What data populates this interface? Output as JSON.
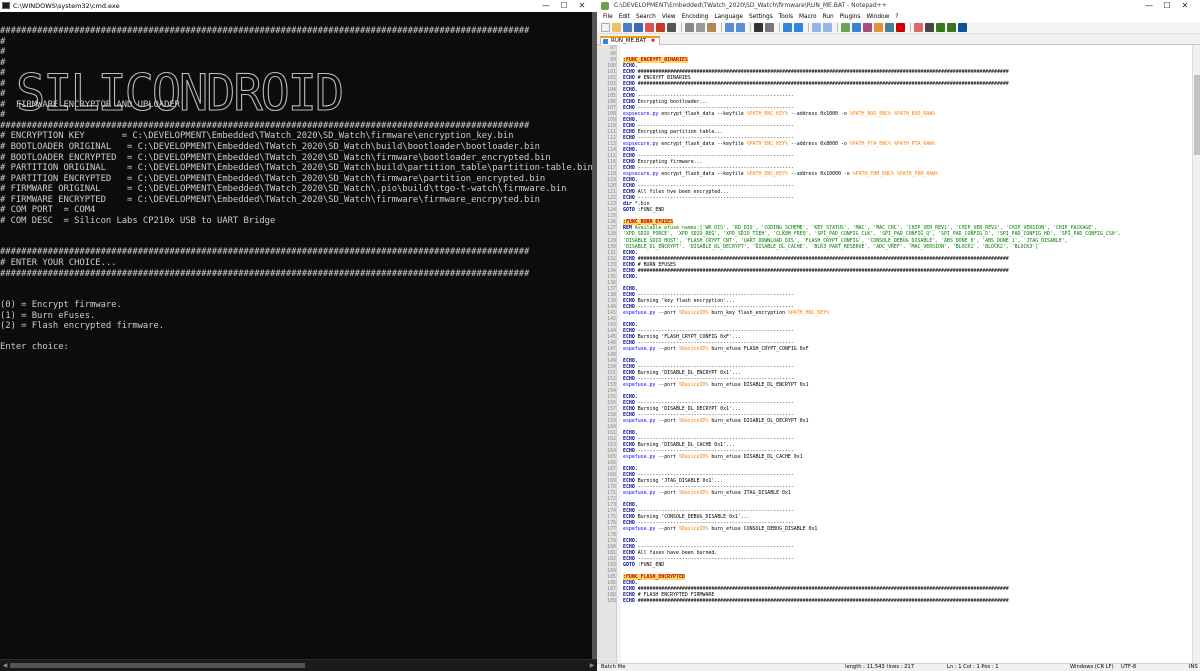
{
  "cmd": {
    "title": "C:\\WINDOWS\\system32\\cmd.exe",
    "lines": [
      "####################################################################################################",
      "#",
      "#",
      "#",
      "#",
      "#",
      "#",
      "#  FIRMWARE ENCRYPTOR AND UPLOADER",
      "#",
      "####################################################################################################",
      "# ENCRYPTION KEY       = C:\\DEVELOPMENT\\Embedded\\TWatch_2020\\SD_Watch\\firmware\\encryption_key.bin",
      "# BOOTLOADER ORIGINAL   = C:\\DEVELOPMENT\\Embedded\\TWatch_2020\\SD_Watch\\build\\bootloader\\bootloader.bin",
      "# BOOTLOADER ENCRYPTED  = C:\\DEVELOPMENT\\Embedded\\TWatch_2020\\SD_Watch\\firmware\\bootloader_encrypted.bin",
      "# PARTITION ORIGINAL    = C:\\DEVELOPMENT\\Embedded\\TWatch_2020\\SD_Watch\\build\\partition_table\\partition-table.bin",
      "# PARTITION ENCRYPTED   = C:\\DEVELOPMENT\\Embedded\\TWatch_2020\\SD_Watch\\firmware\\partition_encrypted.bin",
      "# FIRMWARE ORIGINAL     = C:\\DEVELOPMENT\\Embedded\\TWatch_2020\\SD_Watch\\.pio\\build\\ttgo-t-watch\\firmware.bin",
      "# FIRMWARE ENCRYPTED    = C:\\DEVELOPMENT\\Embedded\\TWatch_2020\\SD_Watch\\firmware\\firmware_encrpyted.bin",
      "# COM PORT  = COM4",
      "# COM DESC  = Silicon Labs CP210x USB to UART Bridge",
      "",
      "",
      "####################################################################################################",
      "# ENTER YOUR CHOICE...",
      "####################################################################################################",
      "",
      "",
      "(0) = Encrypt firmware.",
      "(1) = Burn eFuses.",
      "(2) = Flash encrypted firmware.",
      "",
      "Enter choice:"
    ],
    "ascii_art_text": "SILICONDROID"
  },
  "npp": {
    "title": "C:\\DEVELOPMENT\\Embedded\\TWatch_2020\\SD_Watch\\firmware\\RUN_ME.BAT - Notepad++",
    "menu": [
      "File",
      "Edit",
      "Search",
      "View",
      "Encoding",
      "Language",
      "Settings",
      "Tools",
      "Macro",
      "Run",
      "Plugins",
      "Window",
      "?"
    ],
    "tab_label": "RUN_ME.BAT",
    "first_line_number": 97,
    "code": [
      "",
      "",
      ":FUNC_ENCRYPT_BINARIES",
      "ECHO.",
      "ECHO ##############################################################################################################################",
      "ECHO # ENCRYPT BINARIES",
      "ECHO ##############################################################################################################################",
      "ECHO.",
      "ECHO -----------------------------------------------------",
      "ECHO Encrypting bootloader...",
      "ECHO -----------------------------------------------------",
      "espsecure.py encrypt_flash_data --keyfile %PATH_ENC_KEY% --address 0x1000 -o %PATH_BOO_ENC% %PATH_BOO_RAW%",
      "ECHO.",
      "ECHO -----------------------------------------------------",
      "ECHO Encrypting partition table...",
      "ECHO -----------------------------------------------------",
      "espsecure.py encrypt_flash_data --keyfile %PATH_ENC_KEY% --address 0x8000 -o %PATH_PTA_ENC% %PATH_PTA_RAW%",
      "ECHO.",
      "ECHO -----------------------------------------------------",
      "ECHO Encrypting firmware...",
      "ECHO -----------------------------------------------------",
      "espsecure.py encrypt_flash_data --keyfile %PATH_ENC_KEY% --address 0x10000 -o %PATH_FRM_ENC% %PATH_FRM_RAW%",
      "ECHO.",
      "ECHO -----------------------------------------------------",
      "ECHO All files hve been encrypted...",
      "ECHO -----------------------------------------------------",
      "dir *.bin",
      "GOTO :FUNC_END",
      "",
      ":FUNC_BURN_EFUSES",
      "REM Available efuse names:['WR_DIS', 'RD_DIS', 'CODING_SCHEME', 'KEY_STATUS', 'MAC', 'MAC_CRC', 'CHIP_VER_REV1', 'CHIP_VER_REV2', 'CHIP_VERSION', 'CHIP_PACKAGE',",
      "'XPD_SDIO_FORCE', 'XPD_SDIO_REG', 'XPD_SDIO_TIEH', 'CLK8M_FREQ', 'SPI_PAD_CONFIG_CLK', 'SPI_PAD_CONFIG_Q', 'SPI_PAD_CONFIG_D', 'SPI_PAD_CONFIG_HD', 'SPI_PAD_CONFIG_CS0',",
      "'DISABLE_SDIO_HOST', 'FLASH_CRYPT_CNT', 'UART_DOWNLOAD_DIS', 'FLASH_CRYPT_CONFIG', 'CONSOLE_DEBUG_DISABLE', 'ABS_DONE_0', 'ABS_DONE_1', 'JTAG_DISABLE',",
      "'DISABLE_DL_ENCRYPT', 'DISABLE_DL_DECRYPT', 'DISABLE_DL_CACHE', 'BLK3_PART_RESERVE', 'ADC_VREF', 'MAC_VERSION', 'BLOCK1', 'BLOCK2', 'BLOCK3']",
      "ECHO.",
      "ECHO ##############################################################################################################################",
      "ECHO # BURN EFUSES",
      "ECHO ##############################################################################################################################",
      "ECHO.",
      "",
      "ECHO.",
      "ECHO -----------------------------------------------------",
      "ECHO Burning 'key flash encryption'...",
      "ECHO -----------------------------------------------------",
      "espefuse.py --port %DeviceID% burn_key flash_encryption %PATH_ENC_KEY%",
      "",
      "ECHO.",
      "ECHO -----------------------------------------------------",
      "ECHO Burning 'FLASH_CRYPT_CONFIG 0xF'...",
      "ECHO -----------------------------------------------------",
      "espefuse.py --port %DeviceID% burn_efuse FLASH_CRYPT_CONFIG 0xF",
      "",
      "ECHO.",
      "ECHO -----------------------------------------------------",
      "ECHO Burning 'DISABLE_DL_ENCRYPT 0x1'...",
      "ECHO -----------------------------------------------------",
      "espefuse.py --port %DeviceID% burn_efuse DISABLE_DL_ENCRYPT 0x1",
      "",
      "ECHO.",
      "ECHO -----------------------------------------------------",
      "ECHO Burning 'DISABLE_DL_DECRYPT 0x1'...",
      "ECHO -----------------------------------------------------",
      "espefuse.py --port %DeviceID% burn_efuse DISABLE_DL_DECRYPT 0x1",
      "",
      "ECHO.",
      "ECHO -----------------------------------------------------",
      "ECHO Burning 'DISABLE_DL_CACHE 0x1'...",
      "ECHO -----------------------------------------------------",
      "espefuse.py --port %DeviceID% burn_efuse DISABLE_DL_CACHE 0x1",
      "",
      "ECHO.",
      "ECHO -----------------------------------------------------",
      "ECHO Burning 'JTAG_DISABLE 0x1'...",
      "ECHO -----------------------------------------------------",
      "espefuse.py --port %DeviceID% burn_efuse JTAG_DISABLE 0x1",
      "",
      "ECHO.",
      "ECHO -----------------------------------------------------",
      "ECHO Burning 'CONSOLE_DEBUG_DISABLE 0x1'...",
      "ECHO -----------------------------------------------------",
      "espefuse.py --port %DeviceID% burn_efuse CONSOLE_DEBUG_DISABLE 0x1",
      "",
      "ECHO.",
      "ECHO -----------------------------------------------------",
      "ECHO All fuses have been burned.",
      "ECHO -----------------------------------------------------",
      "GOTO :FUNC_END",
      "",
      ":FUNC_FLASH_ENCRYPTED",
      "ECHO.",
      "ECHO ##############################################################################################################################",
      "ECHO # FLASH ENCRYPTED FIRMWARE",
      "ECHO ##############################################################################################################################"
    ],
    "status": {
      "file_type": "Batch file",
      "length": "length : 11,543",
      "lines": "lines : 217",
      "position": "Ln : 1    Col : 1    Pos : 1",
      "eol": "Windows (CR LF)",
      "encoding": "UTF-8",
      "mode": "INS"
    }
  }
}
